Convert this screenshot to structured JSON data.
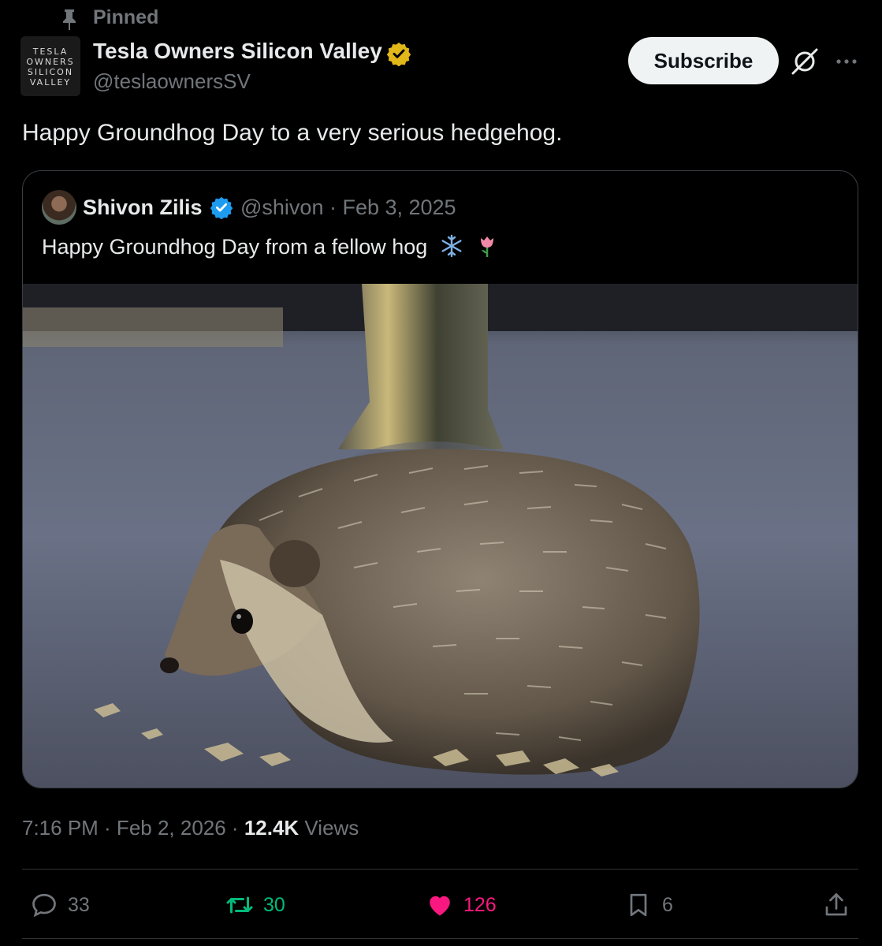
{
  "pinned": {
    "label": "Pinned"
  },
  "author": {
    "avatar_lines": [
      "TESLA",
      "OWNERS",
      "SILICON",
      "VALLEY"
    ],
    "name": "Tesla Owners Silicon Valley",
    "handle": "@teslaownersSV",
    "badge_color": "#e2b719"
  },
  "subscribe_label": "Subscribe",
  "post": {
    "text": "Happy Groundhog Day to a very serious hedgehog."
  },
  "quote": {
    "name": "Shivon Zilis",
    "handle_date": "@shivon · Feb 3, 2025",
    "text": "Happy Groundhog Day from a fellow hog",
    "emojis": [
      "snowflake-icon",
      "tulip-icon"
    ],
    "badge_color": "#1d9bf0"
  },
  "meta": {
    "time_date": "7:16 PM · Feb 2, 2026 · ",
    "views_count": "12.4K",
    "views_label": " Views"
  },
  "actions": {
    "replies": "33",
    "reposts": "30",
    "likes": "126",
    "bookmarks": "6"
  },
  "colors": {
    "background": "#000000",
    "repost": "#00ba7c",
    "like": "#f91880",
    "muted": "#71767b"
  }
}
